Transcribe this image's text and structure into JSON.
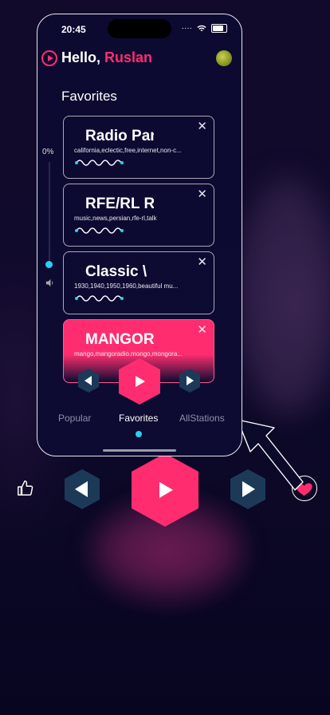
{
  "status_bar": {
    "time": "20:45",
    "signal": "····"
  },
  "header": {
    "greeting": "Hello, ",
    "user_name": "Ruslan"
  },
  "section_title": "Favorites",
  "volume": {
    "label": "0%",
    "level": 0
  },
  "stations": [
    {
      "name": "Radio Par",
      "tags": "california,eclectic,free,internet,non-c...",
      "active": false
    },
    {
      "name": "RFE/RL R",
      "tags": "music,news,persian,rfe-rl,talk",
      "active": false
    },
    {
      "name": "Classic \\",
      "tags": "1930,1940,1950,1960,beautiful mu...",
      "active": false
    },
    {
      "name": "MANGOR",
      "tags": "mango,mangoradio.mongo,mongora...",
      "active": true
    }
  ],
  "tabs": [
    {
      "label": "Popular",
      "selected": false
    },
    {
      "label": "Favorites",
      "selected": true
    },
    {
      "label": "AllStations",
      "selected": false
    }
  ],
  "colors": {
    "accent": "#ff2d6f",
    "highlight": "#2ad0f0",
    "background": "#0c0a30"
  },
  "icons": [
    "logo-play-icon",
    "close-icon",
    "wave-icon",
    "play-icon",
    "previous-icon",
    "next-icon",
    "thumbs-up-icon",
    "heart-icon",
    "speaker-icon"
  ]
}
